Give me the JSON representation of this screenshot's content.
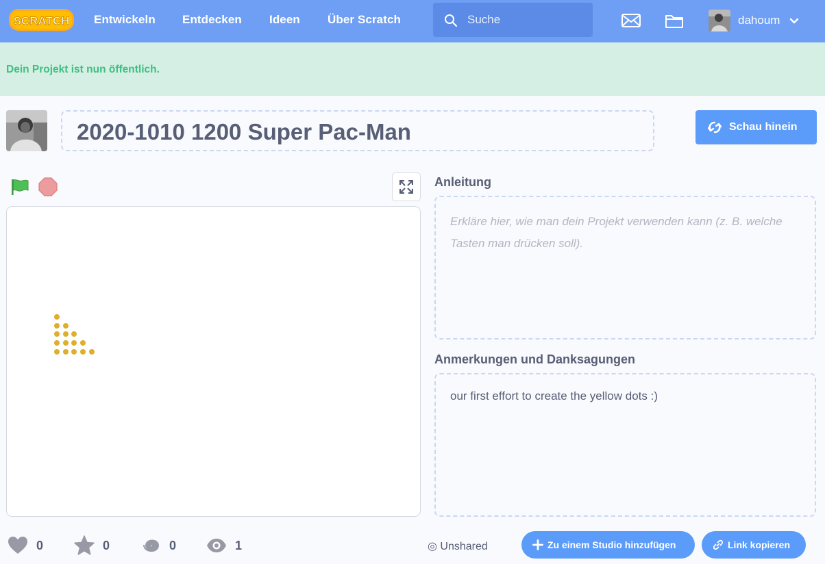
{
  "navbar": {
    "logo_text": "SCRATCH",
    "links": [
      "Entwickeln",
      "Entdecken",
      "Ideen",
      "Über Scratch"
    ],
    "search_placeholder": "Suche",
    "username": "dahoum"
  },
  "alert": {
    "text": "Dein Projekt ist nun öffentlich."
  },
  "project": {
    "title": "2020-1010 1200 Super Pac-Man",
    "see_inside_label": "Schau hinein"
  },
  "instructions": {
    "heading": "Anleitung",
    "placeholder": "Erkläre hier, wie man dein Projekt verwenden kann (z. B. welche Tasten man drücken soll)."
  },
  "notes": {
    "heading": "Anmerkungen und Danksagungen",
    "text": "our first effort to create the yellow dots :)"
  },
  "stats": {
    "loves": "0",
    "favorites": "0",
    "remixes": "0",
    "views": "1"
  },
  "share": {
    "status": "Unshared",
    "add_studio_label": "Zu einem Studio hinzufügen",
    "copy_link_label": "Link kopieren"
  },
  "colors": {
    "navbar": "#6e9ff5",
    "search_bg": "#5b8be6",
    "alert_bg": "#d5efe4",
    "alert_text": "#3fbf82",
    "accent_button": "#5b9bfa",
    "dot_yellow": "#dfae2b",
    "flag_green": "#4cbf56",
    "stop_red": "#ec9c9c"
  },
  "icons": [
    "scratch-logo",
    "search-icon",
    "envelope-icon",
    "folder-icon",
    "chevron-down-icon",
    "remix-icon",
    "green-flag-icon",
    "stop-icon",
    "fullscreen-icon",
    "heart-icon",
    "star-icon",
    "spiral-icon",
    "eye-icon",
    "plus-icon",
    "link-icon"
  ]
}
